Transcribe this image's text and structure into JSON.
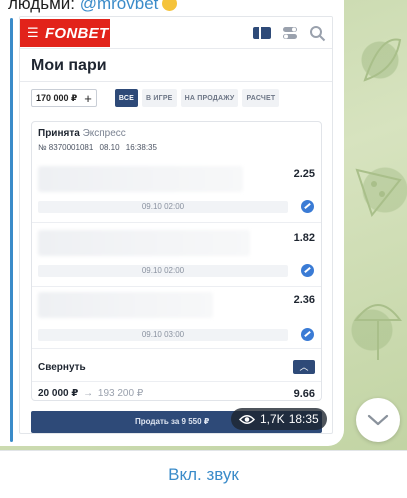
{
  "post": {
    "caption_prefix": "людьми: ",
    "caption_mention": "@mrovbet"
  },
  "fonbet": {
    "logo": "FONBET",
    "page_title": "Мои пари",
    "amount": "170 000 ₽",
    "amount_plus": "+",
    "filters": [
      "ВСЕ",
      "В ИГРЕ",
      "НА ПРОДАЖУ",
      "РАСЧЕТ"
    ],
    "bet": {
      "status": "Принята",
      "kind": "Экспресс",
      "number": "№ 8370001081",
      "date": "08.10",
      "time": "16:38:35",
      "legs": [
        {
          "odds": "2.25",
          "date": "09.10 02:00"
        },
        {
          "odds": "1.82",
          "date": "09.10 02:00"
        },
        {
          "odds": "2.36",
          "date": "09.10 03:00"
        }
      ],
      "collapse_label": "Свернуть",
      "collapse_icon": "chevron-up-icon",
      "stake": "20 000 ₽",
      "arrow": "→",
      "payout": "193 200 ₽",
      "total_odds": "9.66"
    },
    "sell_label": "Продать за 9 550 ₽"
  },
  "telegram": {
    "views": "1,7K",
    "time": "18:35",
    "sound_button": "Вкл. звук"
  },
  "colors": {
    "fonbet_red": "#e2231a",
    "fonbet_navy": "#2e4a78",
    "telegram_blue": "#3a8bc9"
  }
}
